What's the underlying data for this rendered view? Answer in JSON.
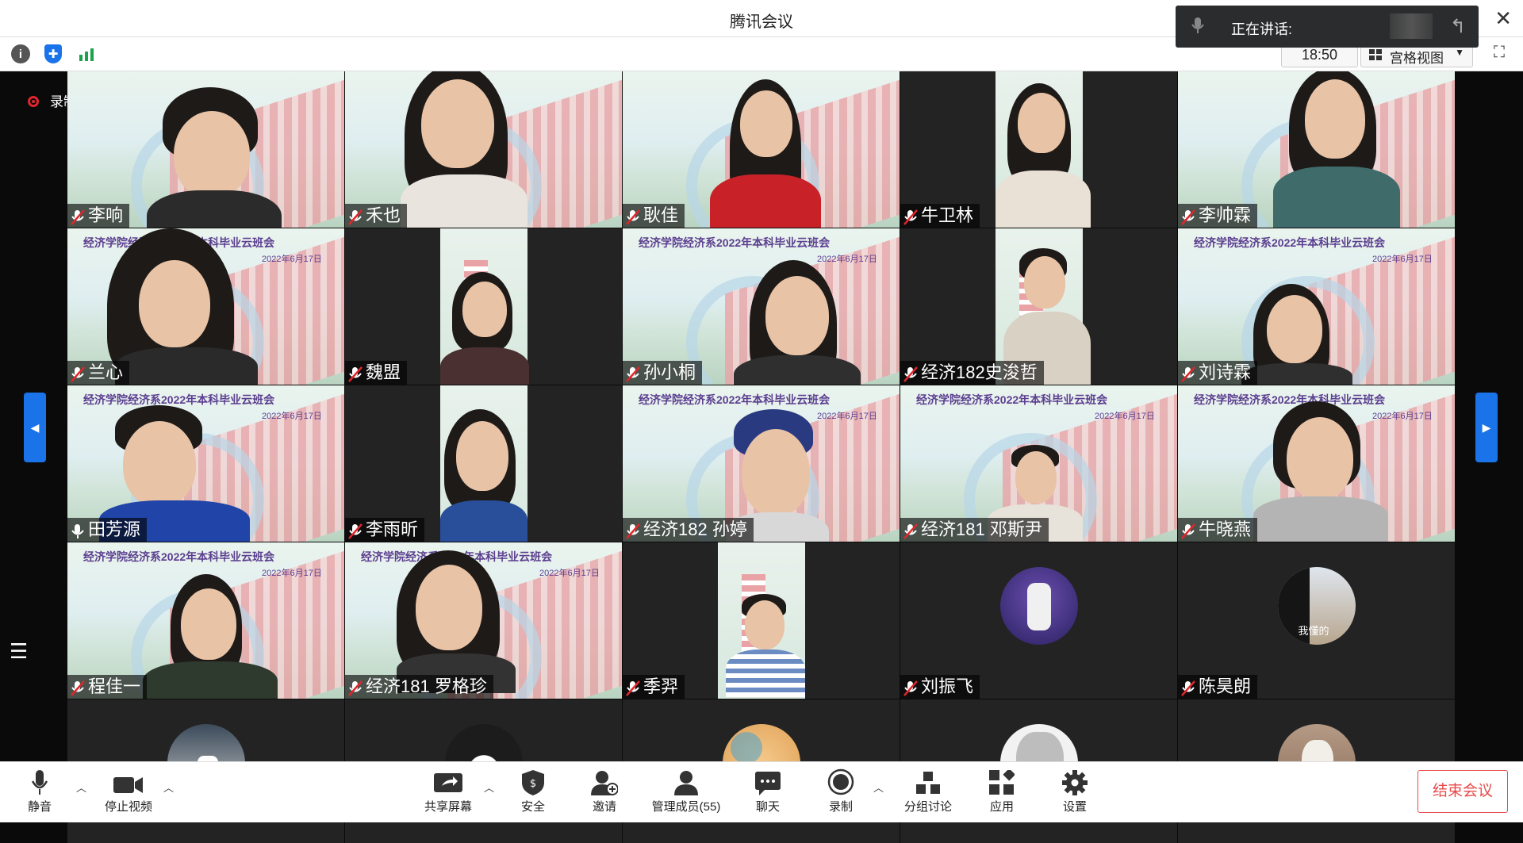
{
  "window": {
    "title": "腾讯会议",
    "close_icon": "close-icon"
  },
  "speaking": {
    "label": "正在讲话:"
  },
  "toolbar": {
    "time": "18:50",
    "view_mode": "宫格视图"
  },
  "recording": {
    "label": "录制中"
  },
  "banner": {
    "text": "经济学院经济系2022年本科毕业云班会",
    "date": "2022年6月17日"
  },
  "participants": [
    {
      "name": "李响"
    },
    {
      "name": "禾也"
    },
    {
      "name": "耿佳"
    },
    {
      "name": "牛卫林"
    },
    {
      "name": "李帅霖"
    },
    {
      "name": "兰心"
    },
    {
      "name": "魏盟"
    },
    {
      "name": "孙小桐"
    },
    {
      "name": "经济182史浚哲"
    },
    {
      "name": "刘诗霖"
    },
    {
      "name": "田芳源"
    },
    {
      "name": "李雨昕"
    },
    {
      "name": "经济182 孙婷"
    },
    {
      "name": "经济181 邓斯尹"
    },
    {
      "name": "牛晓燕"
    },
    {
      "name": "程佳一"
    },
    {
      "name": "经济181 罗格珍"
    },
    {
      "name": "季羿"
    },
    {
      "name": "刘振飞"
    },
    {
      "name": "陈昊朗"
    }
  ],
  "avatar_caption": "我懂的",
  "bottom": {
    "mute": "静音",
    "stop_video": "停止视频",
    "share_screen": "共享屏幕",
    "security": "安全",
    "invite": "邀请",
    "manage_members": "管理成员(55)",
    "chat": "聊天",
    "record": "录制",
    "breakout": "分组讨论",
    "apps": "应用",
    "settings": "设置",
    "end_meeting": "结束会议"
  },
  "colors": {
    "accent": "#1a73e8",
    "danger": "#e84a4a",
    "purple": "#5b3e8f"
  }
}
